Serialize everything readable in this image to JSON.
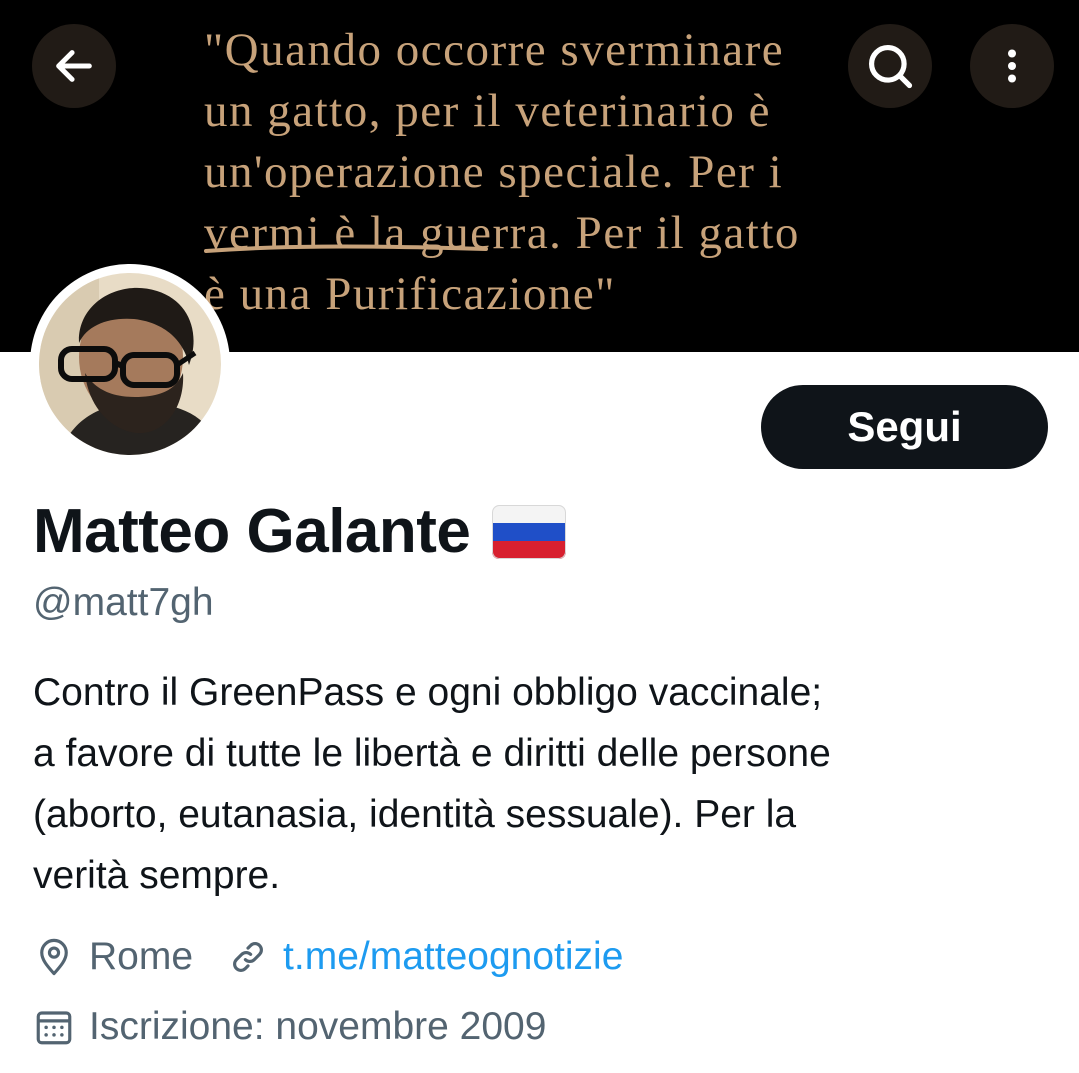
{
  "banner": {
    "quote_lines": [
      "\"Quando occorre sverminare",
      "un gatto, per il veterinario è",
      "un'operazione speciale. Per i",
      "vermi è la guerra. Per il gatto",
      "è una Purificazione\""
    ],
    "text_color": "#c7a27a"
  },
  "nav": {
    "back_icon": "arrow-left-icon",
    "search_icon": "search-icon",
    "more_icon": "more-vertical-icon"
  },
  "profile": {
    "name": "Matteo Galante",
    "name_emoji": "russia-flag",
    "handle": "@matt7gh",
    "follow_label": "Segui",
    "bio_lines": [
      "Contro il GreenPass e ogni obbligo vaccinale;",
      "a favore di tutte le libertà e diritti delle persone",
      "(aborto, eutanasia, identità sessuale). Per la",
      "verità sempre."
    ],
    "location": "Rome",
    "link": "t.me/matteognotizie",
    "joined": "Iscrizione: novembre 2009"
  },
  "colors": {
    "text_primary": "#0f1419",
    "text_secondary": "#536471",
    "link": "#1d9bf0",
    "follow_bg": "#0f1419"
  }
}
